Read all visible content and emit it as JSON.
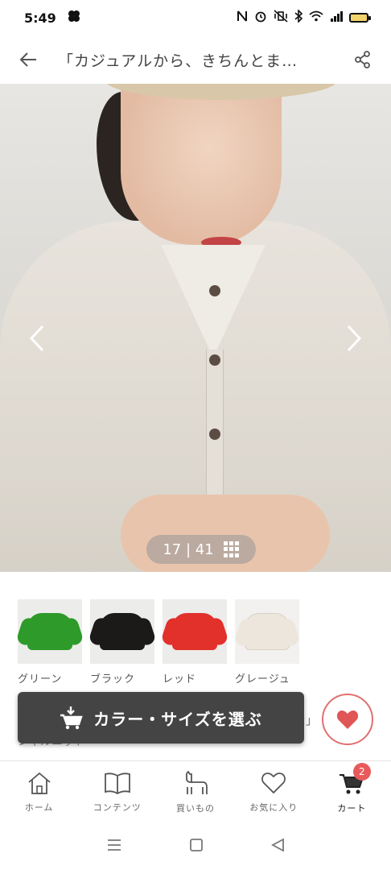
{
  "status_bar": {
    "time": "5:49"
  },
  "header": {
    "title": "「カジュアルから、きちんとま…"
  },
  "gallery": {
    "current": "17",
    "separator": "|",
    "total": "41"
  },
  "swatches": [
    {
      "label": "グリーン",
      "color": "#2e9a2a"
    },
    {
      "label": "ブラック",
      "color": "#1c1a19"
    },
    {
      "label": "レッド",
      "color": "#e2302b"
    },
    {
      "label": "グレージュ",
      "color": "#ece6dc"
    }
  ],
  "partial_text": {
    "left": "シャルニット",
    "right": "を」"
  },
  "cta": {
    "label": "カラー・サイズを選ぶ"
  },
  "tabbar": {
    "items": [
      {
        "label": "ホーム",
        "icon": "home-icon"
      },
      {
        "label": "コンテンツ",
        "icon": "book-icon"
      },
      {
        "label": "買いもの",
        "icon": "alpaca-icon"
      },
      {
        "label": "お気に入り",
        "icon": "heart-icon"
      },
      {
        "label": "カート",
        "icon": "cart-icon"
      }
    ],
    "cart_badge": "2"
  },
  "colors": {
    "cta_bg": "#444444",
    "accent": "#e85a5a"
  }
}
